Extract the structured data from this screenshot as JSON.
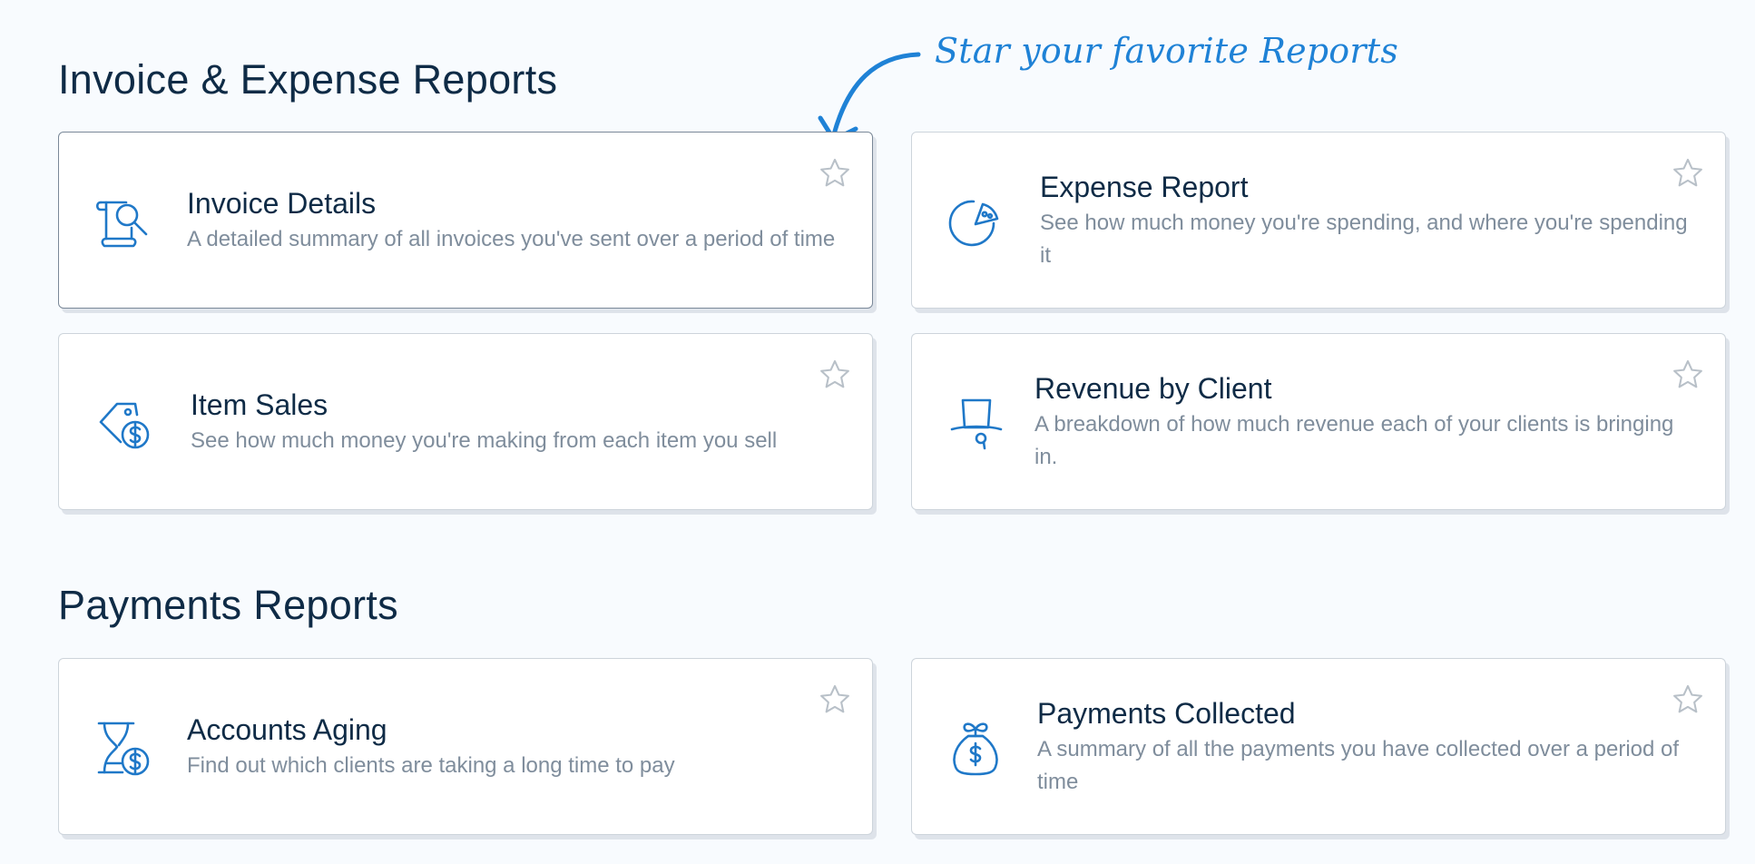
{
  "colors": {
    "accent": "#1f82d6",
    "icon": "#1f78c8",
    "title_text": "#0f2b46",
    "description_text": "#7f8d9c",
    "star_outline": "#b8c0c8",
    "background": "#f8fbfe"
  },
  "callout": {
    "text": "Star your favorite Reports"
  },
  "sections": {
    "invoice_expense": {
      "title": "Invoice & Expense Reports",
      "cards": [
        {
          "icon": "magnifier-document-icon",
          "title": "Invoice Details",
          "description": "A detailed summary of all invoices you've sent over a period of time",
          "favorited": false
        },
        {
          "icon": "pie-chart-icon",
          "title": "Expense Report",
          "description": "See how much money you're spending, and where you're spending it",
          "favorited": false
        },
        {
          "icon": "price-tag-dollar-icon",
          "title": "Item Sales",
          "description": "See how much money you're making from each item you sell",
          "favorited": false
        },
        {
          "icon": "top-hat-icon",
          "title": "Revenue by Client",
          "description": "A breakdown of how much revenue each of your clients is bringing in.",
          "favorited": false
        }
      ]
    },
    "payments": {
      "title": "Payments Reports",
      "cards": [
        {
          "icon": "hourglass-dollar-icon",
          "title": "Accounts Aging",
          "description": "Find out which clients are taking a long time to pay",
          "favorited": false
        },
        {
          "icon": "money-bag-icon",
          "title": "Payments Collected",
          "description": "A summary of all the payments you have collected over a period of time",
          "favorited": false
        }
      ]
    }
  }
}
